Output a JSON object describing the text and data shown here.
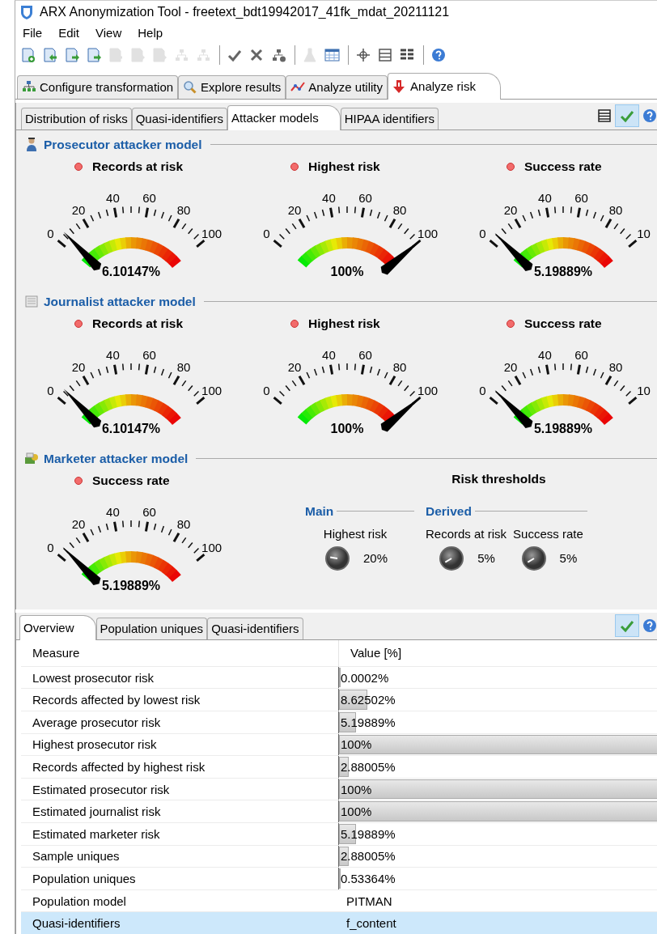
{
  "window": {
    "title": "ARX Anonymization Tool - freetext_bdt19942017_41fk_mdat_20211121"
  },
  "menu": [
    "File",
    "Edit",
    "View",
    "Help"
  ],
  "toolbar": [
    {
      "kind": "doc-plus",
      "disabled": false
    },
    {
      "kind": "doc-left",
      "disabled": false
    },
    {
      "kind": "doc-right",
      "disabled": false
    },
    {
      "kind": "doc-right",
      "disabled": false
    },
    {
      "kind": "doc-left",
      "disabled": true
    },
    {
      "kind": "doc-right",
      "disabled": true
    },
    {
      "kind": "doc-right",
      "disabled": true
    },
    {
      "kind": "tree-left",
      "disabled": true
    },
    {
      "kind": "tree-right",
      "disabled": true
    },
    {
      "kind": "separator"
    },
    {
      "kind": "check",
      "disabled": false
    },
    {
      "kind": "cross",
      "disabled": false
    },
    {
      "kind": "tree-plus",
      "disabled": false
    },
    {
      "kind": "separator"
    },
    {
      "kind": "flask",
      "disabled": true
    },
    {
      "kind": "table",
      "disabled": false
    },
    {
      "kind": "separator"
    },
    {
      "kind": "crosshair",
      "disabled": false
    },
    {
      "kind": "rows",
      "disabled": false
    },
    {
      "kind": "grid",
      "disabled": false
    },
    {
      "kind": "separator"
    },
    {
      "kind": "help",
      "disabled": false
    }
  ],
  "main_tabs": [
    {
      "label": "Configure transformation",
      "kind": "tree",
      "selected": false
    },
    {
      "label": "Explore results",
      "kind": "search",
      "selected": false
    },
    {
      "label": "Analyze utility",
      "kind": "chart",
      "selected": false
    },
    {
      "label": "Analyze risk",
      "kind": "risk",
      "selected": true
    }
  ],
  "sub_tabs": [
    {
      "label": "Distribution of risks",
      "selected": false
    },
    {
      "label": "Quasi-identifiers",
      "selected": false
    },
    {
      "label": "Attacker models",
      "selected": true
    },
    {
      "label": "HIPAA identifiers",
      "selected": false
    }
  ],
  "sections": [
    {
      "title": "Prosecutor attacker model",
      "kind": "person",
      "gauges": [
        {
          "label": "Records at risk",
          "value": "6.10147%",
          "ticks": [
            "0",
            "20",
            "40",
            "60",
            "80",
            "100"
          ]
        },
        {
          "label": "Highest risk",
          "value": "100%",
          "ticks": [
            "0",
            "20",
            "40",
            "60",
            "80",
            "100"
          ]
        },
        {
          "label": "Success rate",
          "value": "5.19889%",
          "ticks": [
            "0",
            "20",
            "40",
            "60",
            "80",
            "10"
          ]
        }
      ]
    },
    {
      "title": "Journalist attacker model",
      "kind": "paper",
      "gauges": [
        {
          "label": "Records at risk",
          "value": "6.10147%",
          "ticks": [
            "0",
            "20",
            "40",
            "60",
            "80",
            "100"
          ]
        },
        {
          "label": "Highest risk",
          "value": "100%",
          "ticks": [
            "0",
            "20",
            "40",
            "60",
            "80",
            "100"
          ]
        },
        {
          "label": "Success rate",
          "value": "5.19889%",
          "ticks": [
            "0",
            "20",
            "40",
            "60",
            "80",
            "10"
          ]
        }
      ]
    },
    {
      "title": "Marketer attacker model",
      "kind": "money",
      "gauges": [
        {
          "label": "Success rate",
          "value": "5.19889%",
          "ticks": [
            "0",
            "20",
            "40",
            "60",
            "80",
            "100"
          ]
        }
      ],
      "thresholds": {
        "title": "Risk thresholds",
        "groups": [
          {
            "title": "Main",
            "knobs": [
              {
                "label": "Highest risk",
                "value": "20%"
              }
            ]
          },
          {
            "title": "Derived",
            "knobs": [
              {
                "label": "Records at risk",
                "value": "5%"
              },
              {
                "label": "Success rate",
                "value": "5%"
              }
            ]
          }
        ]
      }
    }
  ],
  "bottom_tabs": [
    {
      "label": "Overview",
      "selected": true
    },
    {
      "label": "Population uniques",
      "selected": false
    },
    {
      "label": "Quasi-identifiers",
      "selected": false
    }
  ],
  "table": {
    "columns": [
      "Measure",
      "Value [%]"
    ],
    "rows": [
      {
        "measure": "Lowest prosecutor risk",
        "kind": "bar",
        "level": 2e-06,
        "value": "0.0002%",
        "selected": false
      },
      {
        "measure": "Records affected by lowest risk",
        "kind": "bar",
        "level": 0.0862502,
        "value": "8.62502%",
        "selected": false
      },
      {
        "measure": "Average prosecutor risk",
        "kind": "bar",
        "level": 0.0519889,
        "value": "5.19889%",
        "selected": false
      },
      {
        "measure": "Highest prosecutor risk",
        "kind": "bar",
        "level": 1,
        "value": "100%",
        "selected": false
      },
      {
        "measure": "Records affected by highest risk",
        "kind": "bar",
        "level": 0.0288005,
        "value": "2.88005%",
        "selected": false
      },
      {
        "measure": "Estimated prosecutor risk",
        "kind": "bar",
        "level": 1,
        "value": "100%",
        "selected": false
      },
      {
        "measure": "Estimated journalist risk",
        "kind": "bar",
        "level": 1,
        "value": "100%",
        "selected": false
      },
      {
        "measure": "Estimated marketer risk",
        "kind": "bar",
        "level": 0.0519889,
        "value": "5.19889%",
        "selected": false
      },
      {
        "measure": "Sample uniques",
        "kind": "bar",
        "level": 0.0288005,
        "value": "2.88005%",
        "selected": false
      },
      {
        "measure": "Population uniques",
        "kind": "bar",
        "level": 0.0053364,
        "value": "0.53364%",
        "selected": false
      },
      {
        "measure": "Population model",
        "kind": "text",
        "value": "PITMAN",
        "selected": false
      },
      {
        "measure": "Quasi-identifiers",
        "kind": "text",
        "value": "f_content",
        "selected": true
      }
    ]
  }
}
